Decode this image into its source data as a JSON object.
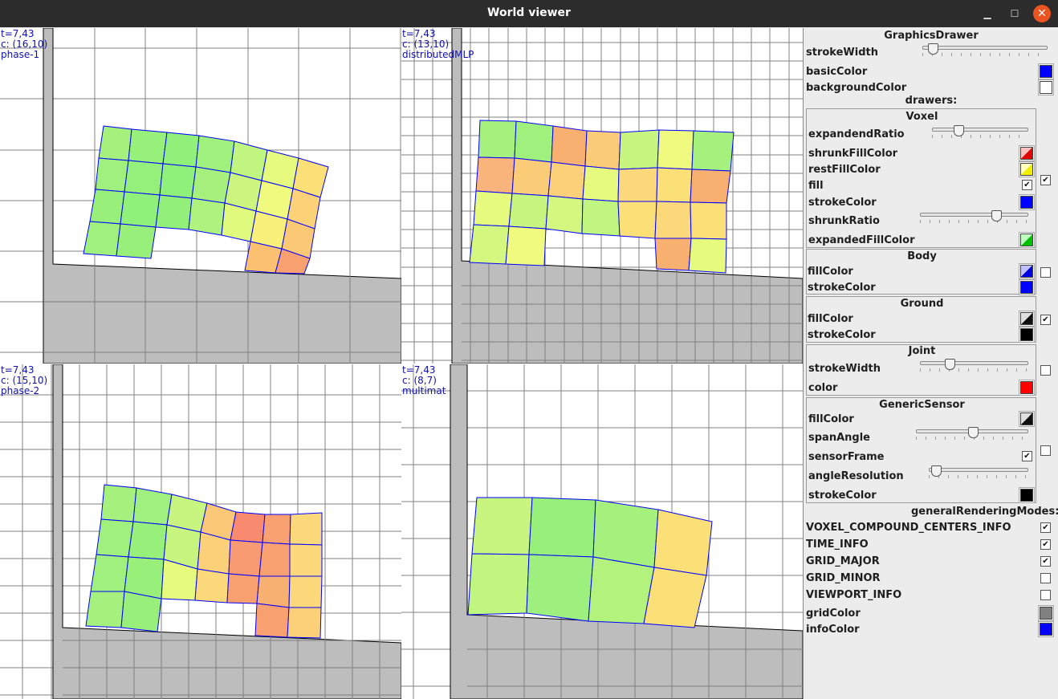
{
  "window": {
    "title": "World viewer",
    "min_icon": "minimize-icon",
    "max_icon": "maximize-icon",
    "close_icon": "close-icon"
  },
  "viewports": [
    {
      "t": "t=7,43",
      "c": "c: (16,10)",
      "name": "phase-1"
    },
    {
      "t": "t=7,43",
      "c": "c: (13,10)",
      "name": "distributedMLP"
    },
    {
      "t": "t=7,43",
      "c": "c: (15,10)",
      "name": "phase-2"
    },
    {
      "t": "t=7,43",
      "c": "c: (8,7)",
      "name": "multimat"
    }
  ],
  "colors": {
    "grid": "#808080",
    "info": "#0000ff",
    "ground": "#bdbdbd",
    "stroke": "#0000ff",
    "background": "#ffffff"
  },
  "panel": {
    "graphics_drawer": {
      "title": "GraphicsDrawer",
      "stroke_width": "strokeWidth",
      "stroke_width_value": 0.05,
      "basic_color": "basicColor",
      "background_color": "backgroundColor"
    },
    "drawers_title": "drawers:",
    "voxel": {
      "title": "Voxel",
      "expanded_ratio": "expandendRatio",
      "expanded_ratio_value": 0.25,
      "shrunk_fill_color": "shrunkFillColor",
      "rest_fill_color": "restFillColor",
      "fill": "fill",
      "stroke_color": "strokeColor",
      "shrunk_ratio": "shrunkRatio",
      "shrunk_ratio_value": 0.72,
      "expanded_fill_color": "expandedFillColor"
    },
    "body": {
      "title": "Body",
      "fill_color": "fillColor",
      "stroke_color": "strokeColor"
    },
    "ground": {
      "title": "Ground",
      "fill_color": "fillColor",
      "stroke_color": "strokeColor"
    },
    "joint": {
      "title": "Joint",
      "stroke_width": "strokeWidth",
      "stroke_width_value": 0.25,
      "color": "color"
    },
    "sensor": {
      "title": "GenericSensor",
      "fill_color": "fillColor",
      "span_angle": "spanAngle",
      "span_angle_value": 0.5,
      "sensor_frame": "sensorFrame",
      "angle_resolution": "angleResolution",
      "angle_resolution_value": 0.03,
      "stroke_color": "strokeColor"
    },
    "modes_title": "generalRenderingModes:",
    "modes": [
      {
        "label": "VOXEL_COMPOUND_CENTERS_INFO",
        "checked": true
      },
      {
        "label": "TIME_INFO",
        "checked": true
      },
      {
        "label": "GRID_MAJOR",
        "checked": true
      },
      {
        "label": "GRID_MINOR",
        "checked": false
      },
      {
        "label": "VIEWPORT_INFO",
        "checked": false
      }
    ],
    "grid_color": "gridColor",
    "info_color": "infoColor"
  },
  "check_mark": "✔"
}
